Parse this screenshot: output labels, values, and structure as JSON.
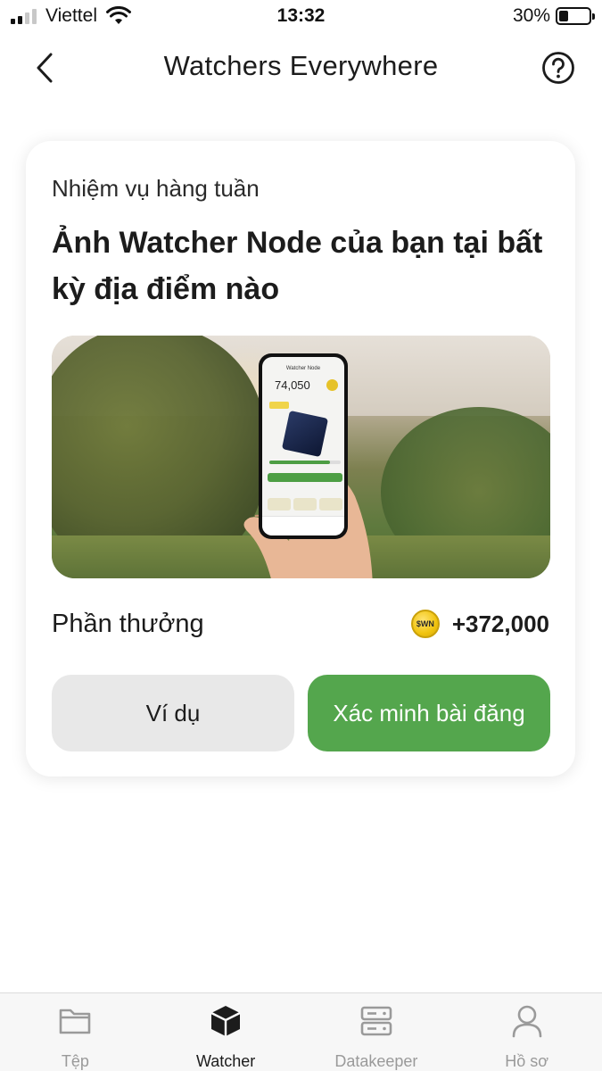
{
  "status_bar": {
    "carrier": "Viettel",
    "time": "13:32",
    "battery": "30%",
    "battery_level": 0.3
  },
  "header": {
    "title": "Watchers Everywhere",
    "back_icon": "chevron-left-icon",
    "help_icon": "question-circle-icon"
  },
  "task": {
    "subtitle": "Nhiệm vụ hàng tuần",
    "title": "Ảnh Watcher Node của bạn tại bất kỳ địa điểm nào",
    "image": {
      "phone_screen_title": "Watcher Node",
      "phone_screen_amount": "74,050"
    },
    "reward_label": "Phần thưởng",
    "reward_coin_label": "$WN",
    "reward_amount": "+372,000",
    "example_button": "Ví dụ",
    "verify_button": "Xác minh bài đăng"
  },
  "colors": {
    "accent_green": "#54a64d",
    "secondary_button": "#e8e8e8",
    "coin_gold": "#f1c40f"
  },
  "tab_bar": {
    "tabs": [
      {
        "label": "Tệp",
        "icon": "folder-icon",
        "active": false
      },
      {
        "label": "Watcher",
        "icon": "cube-icon",
        "active": true
      },
      {
        "label": "Datakeeper",
        "icon": "server-icon",
        "active": false
      },
      {
        "label": "Hồ sơ",
        "icon": "user-icon",
        "active": false
      }
    ]
  }
}
